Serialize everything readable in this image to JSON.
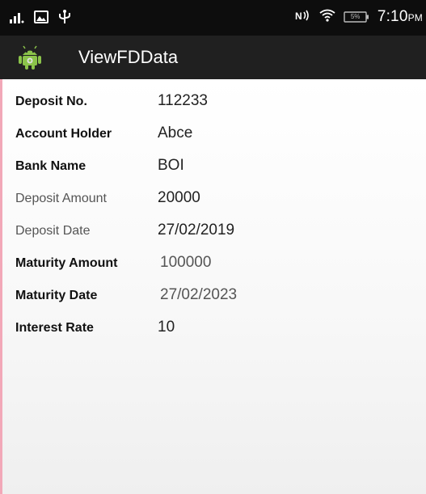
{
  "status_bar": {
    "time": "7:10",
    "ampm": "PM",
    "battery_percent": "5%",
    "icons": [
      "signal-icon",
      "image-icon",
      "usb-icon",
      "volte-icon",
      "wifi-icon",
      "battery-icon"
    ]
  },
  "app_bar": {
    "title": "ViewFDData",
    "icon": "android-icon"
  },
  "fields": [
    {
      "label": "Deposit No.",
      "value": "112233"
    },
    {
      "label": "Account Holder",
      "value": "Abce"
    },
    {
      "label": "Bank Name",
      "value": "BOI"
    },
    {
      "label": "Deposit Amount",
      "value": "20000"
    },
    {
      "label": "Deposit Date",
      "value": "27/02/2019"
    },
    {
      "label": "Maturity Amount",
      "value": "100000"
    },
    {
      "label": "Maturity Date",
      "value": "27/02/2023"
    },
    {
      "label": "Interest Rate",
      "value": "10"
    }
  ],
  "colors": {
    "status_bar": "#0d0d0d",
    "app_bar": "#202020",
    "android_green": "#8bc34a",
    "accent_strip": "#f2a8b8"
  }
}
